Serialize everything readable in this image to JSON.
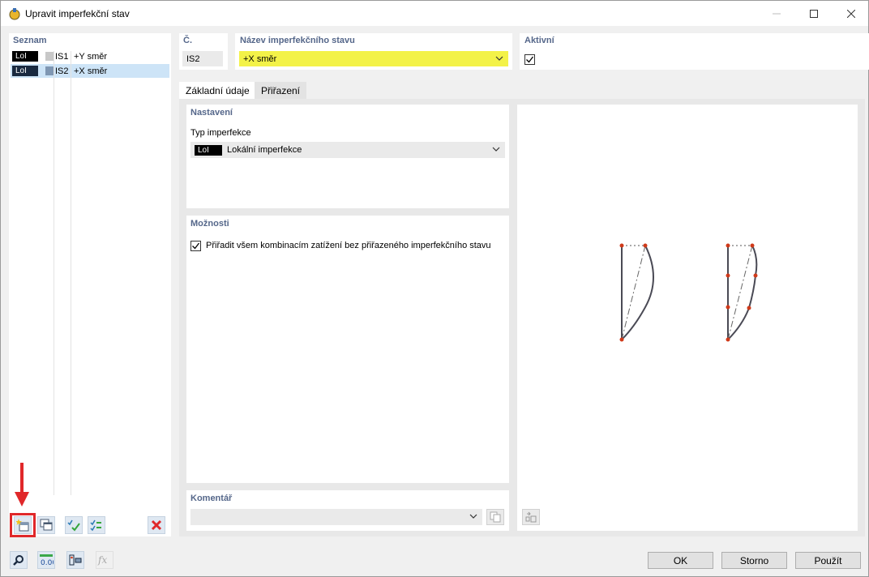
{
  "window": {
    "title": "Upravit imperfekční stav"
  },
  "list": {
    "title": "Seznam",
    "items": [
      {
        "badge": "LoI",
        "code": "IS1",
        "name": "+Y směr",
        "color": "#c8c8c8",
        "selected": false
      },
      {
        "badge": "LoI",
        "code": "IS2",
        "name": "+X směr",
        "color": "#7f97b3",
        "selected": true
      }
    ]
  },
  "header": {
    "number_label": "Č.",
    "number_value": "IS2",
    "name_label": "Název imperfekčního stavu",
    "name_value": "+X směr",
    "active_label": "Aktivní",
    "active_checked": true
  },
  "tabs": [
    {
      "label": "Základní údaje",
      "active": true
    },
    {
      "label": "Přiřazení",
      "active": false
    }
  ],
  "settings": {
    "title": "Nastavení",
    "type_label": "Typ imperfekce",
    "type_badge": "LoI",
    "type_value": "Lokální imperfekce"
  },
  "options": {
    "title": "Možnosti",
    "assign_all_label": "Přiřadit všem kombinacím zatížení bez přiřazeného imperfekčního stavu",
    "assign_all_checked": true
  },
  "comment": {
    "title": "Komentář",
    "value": ""
  },
  "footer": {
    "ok": "OK",
    "cancel": "Storno",
    "apply": "Použít"
  },
  "colors": {
    "highlight": "#e0282a",
    "name_field": "#f3f248",
    "section_title": "#55678a",
    "selection": "#cde4f7"
  }
}
